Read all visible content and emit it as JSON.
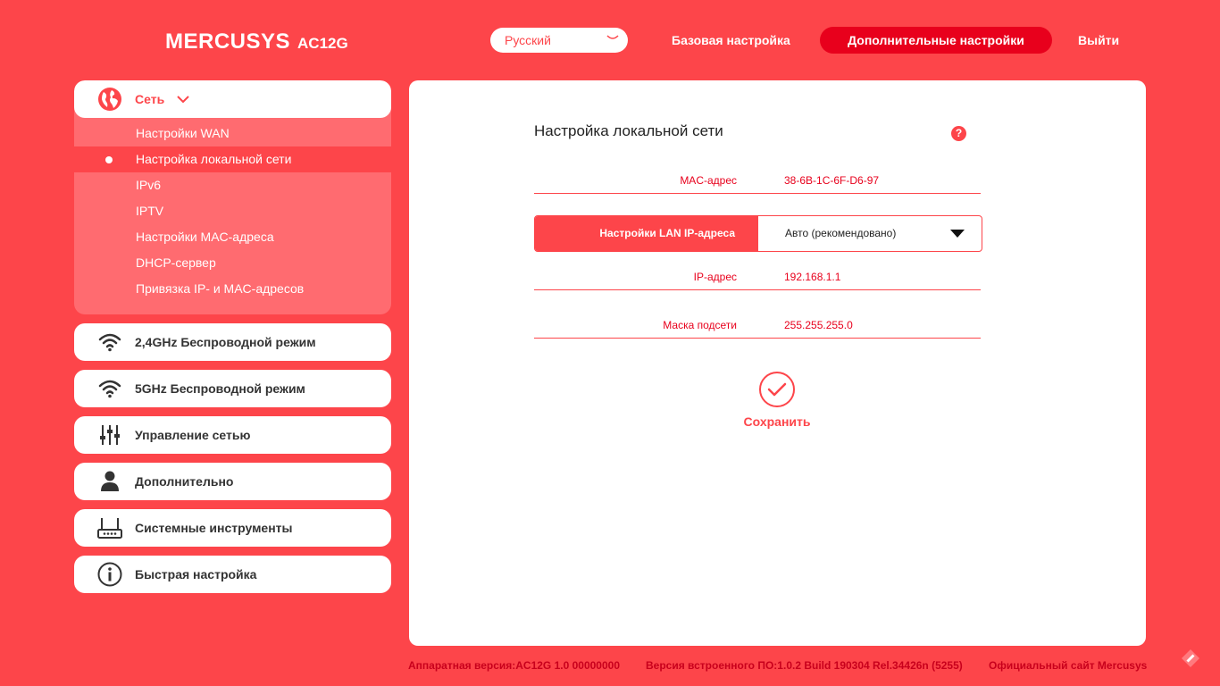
{
  "header": {
    "brand": "MERCUSYS",
    "model": "AC12G",
    "language": "Русский",
    "nav_basic": "Базовая настройка",
    "nav_advanced": "Дополнительные настройки",
    "nav_logout": "Выйти"
  },
  "sidebar": {
    "network": {
      "label": "Сеть",
      "icon": "globe-icon",
      "items": [
        {
          "label": "Настройки WAN"
        },
        {
          "label": "Настройка локальной сети",
          "active": true
        },
        {
          "label": "IPv6"
        },
        {
          "label": "IPTV"
        },
        {
          "label": "Настройки MAC-адреса"
        },
        {
          "label": "DHCP-сервер"
        },
        {
          "label": "Привязка IP- и MAC-адресов"
        }
      ]
    },
    "menu": [
      {
        "label": "2,4GHz Беспроводной режим",
        "icon": "wifi-icon"
      },
      {
        "label": "5GHz Беспроводной режим",
        "icon": "wifi-icon"
      },
      {
        "label": "Управление сетью",
        "icon": "sliders-icon"
      },
      {
        "label": "Дополнительно",
        "icon": "user-icon"
      },
      {
        "label": "Системные инструменты",
        "icon": "router-icon"
      },
      {
        "label": "Быстрая настройка",
        "icon": "info-icon"
      }
    ]
  },
  "main": {
    "title": "Настройка локальной сети",
    "mac_label": "MAC-адрес",
    "mac_value": "38-6B-1C-6F-D6-97",
    "lan_ip_label": "Настройки LAN IP-адреса",
    "lan_ip_value": "Авто (рекомендовано)",
    "ip_label": "IP-адрес",
    "ip_value": "192.168.1.1",
    "mask_label": "Маска подсети",
    "mask_value": "255.255.255.0",
    "save_label": "Сохранить"
  },
  "footer": {
    "hardware": "Аппаратная версия:AC12G 1.0 00000000",
    "firmware": "Версия встроенного ПО:1.0.2 Build 190304 Rel.34426n (5255)",
    "site": "Официальный сайт Mercusys"
  },
  "colors": {
    "background": "#fd454a",
    "accent_dark": "#e8001c",
    "submenu": "#ff6b70"
  }
}
